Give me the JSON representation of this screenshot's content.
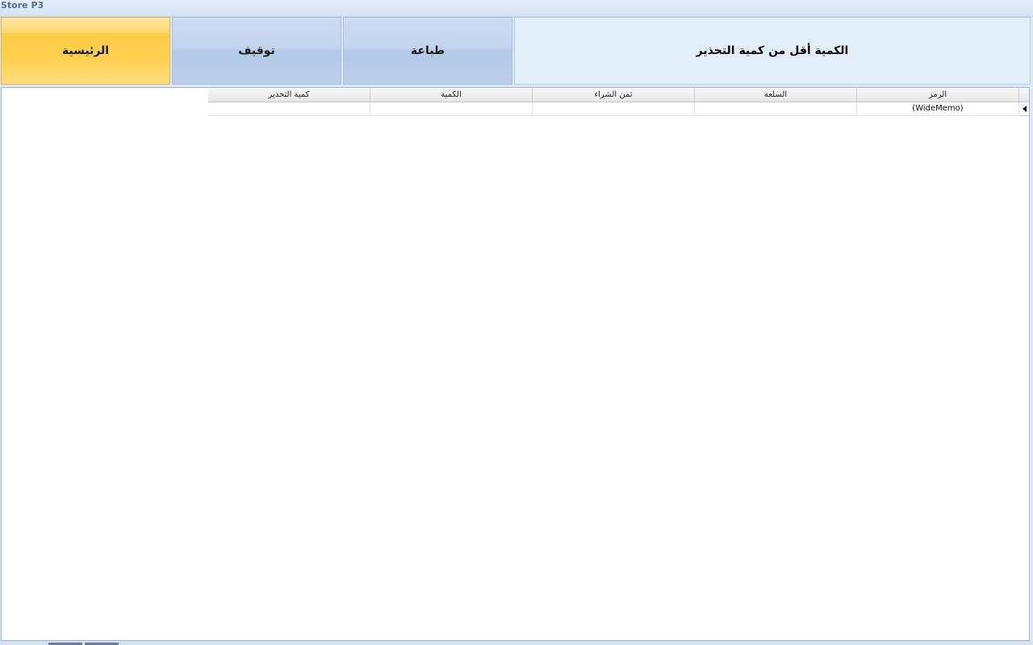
{
  "window": {
    "title": "Store P3"
  },
  "toolbar": {
    "home_label": "الرئيسية",
    "stop_label": "توقيف",
    "print_label": "طباعة",
    "header_title": "الكمية أقل من كمية التحذير"
  },
  "grid": {
    "columns": [
      "كمية التحذير",
      "الكمية",
      "ثمن الشراء",
      "السلعة",
      "الرمز"
    ],
    "rows": [
      [
        "",
        "",
        "",
        "",
        "(WideMemo)"
      ]
    ]
  },
  "colors": {
    "accent_home": "#ffcc47",
    "button_blue": "#c3d5ee",
    "header_bg": "#e3eefb"
  }
}
